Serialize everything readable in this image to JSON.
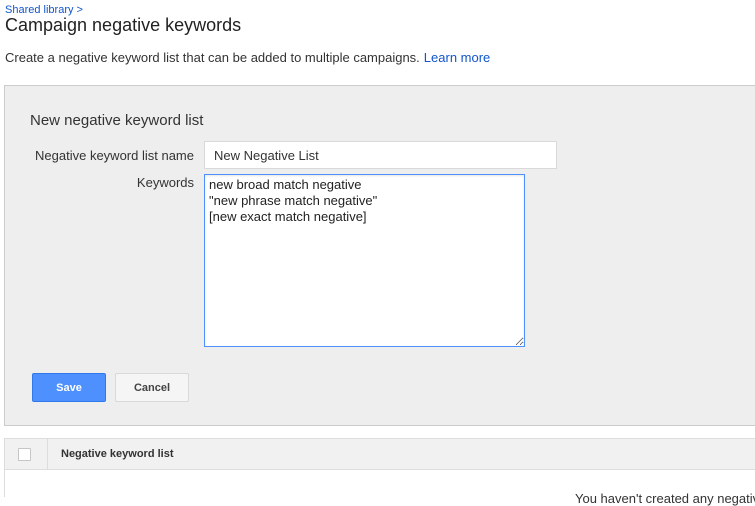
{
  "header": {
    "breadcrumb": "Shared library >",
    "title": "Campaign negative keywords",
    "description": "Create a negative keyword list that can be added to multiple campaigns.",
    "learn_more": "Learn more"
  },
  "form": {
    "heading": "New negative keyword list",
    "name_label": "Negative keyword list name",
    "name_value": "New Negative List",
    "keywords_label": "Keywords",
    "keywords_value": "new broad match negative\n\"new phrase match negative\"\n[new exact match negative]",
    "save_label": "Save",
    "cancel_label": "Cancel"
  },
  "table": {
    "column_header": "Negative keyword list",
    "footer_partial": "You haven't created any negativ"
  },
  "colors": {
    "primary_button": "#4d90fe",
    "link": "#1155cc",
    "panel_background": "#eeeeee"
  }
}
